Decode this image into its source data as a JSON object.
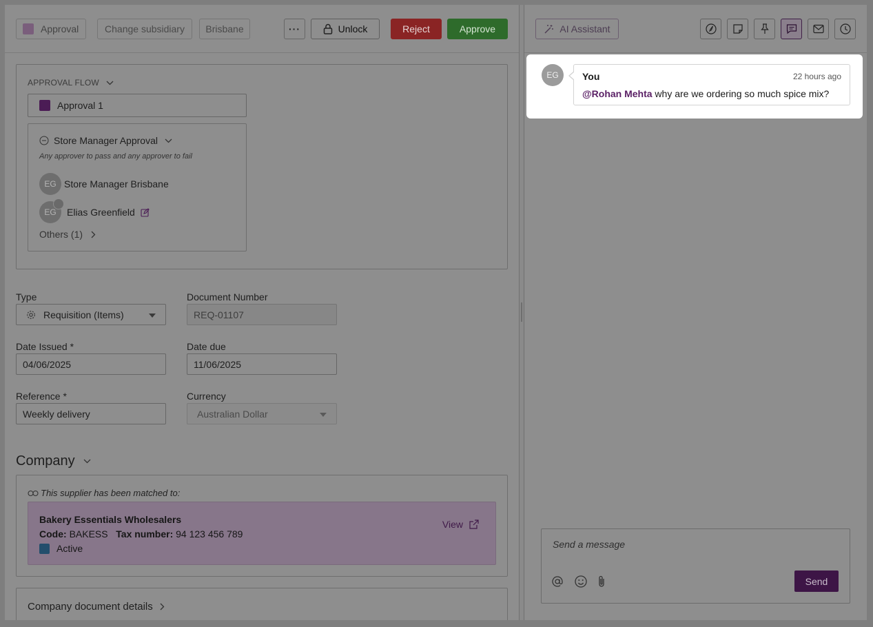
{
  "toolbar": {
    "approval_label": "Approval",
    "change_subsidiary_label": "Change subsidiary",
    "location_label": "Brisbane",
    "more_label": "···",
    "unlock_label": "Unlock",
    "reject_label": "Reject",
    "approve_label": "Approve"
  },
  "approval_flow": {
    "title": "APPROVAL FLOW",
    "approval_name": "Approval 1",
    "stage": {
      "name": "Store Manager Approval",
      "rule": "Any approver to pass and any approver to fail",
      "approvers": [
        {
          "initials": "EG",
          "name": "Store Manager Brisbane"
        },
        {
          "initials": "EG",
          "name": "Elias Greenfield"
        }
      ],
      "others_label": "Others (1)"
    }
  },
  "form": {
    "type": {
      "label": "Type",
      "value": "Requisition (Items)"
    },
    "document_number": {
      "label": "Document Number",
      "value": "REQ-01107"
    },
    "date_issued": {
      "label": "Date Issued *",
      "value": "04/06/2025"
    },
    "date_due": {
      "label": "Date due",
      "value": "11/06/2025"
    },
    "reference": {
      "label": "Reference *",
      "value": "Weekly delivery"
    },
    "currency": {
      "label": "Currency",
      "value": "Australian Dollar"
    }
  },
  "company": {
    "title": "Company",
    "matched_text": "This supplier has been matched to:",
    "supplier_name": "Bakery Essentials Wholesalers",
    "code_label": "Code:",
    "code_value": "BAKESS",
    "tax_label": "Tax number:",
    "tax_value": "94 123 456 789",
    "status": "Active",
    "view_label": "View"
  },
  "company_document_details": {
    "title": "Company document details"
  },
  "right_panel": {
    "ai_assistant_label": "AI Assistant",
    "comment": {
      "initials": "EG",
      "author": "You",
      "time": "22 hours ago",
      "mention": "@Rohan Mehta",
      "text": " why are we ordering so much spice mix?"
    },
    "composer": {
      "placeholder": "Send a message",
      "send_label": "Send"
    }
  },
  "colors": {
    "reject": "#8a2424",
    "approve": "#2e6b2b",
    "brand": "#4b1c55",
    "active_status": "#234e6c"
  }
}
